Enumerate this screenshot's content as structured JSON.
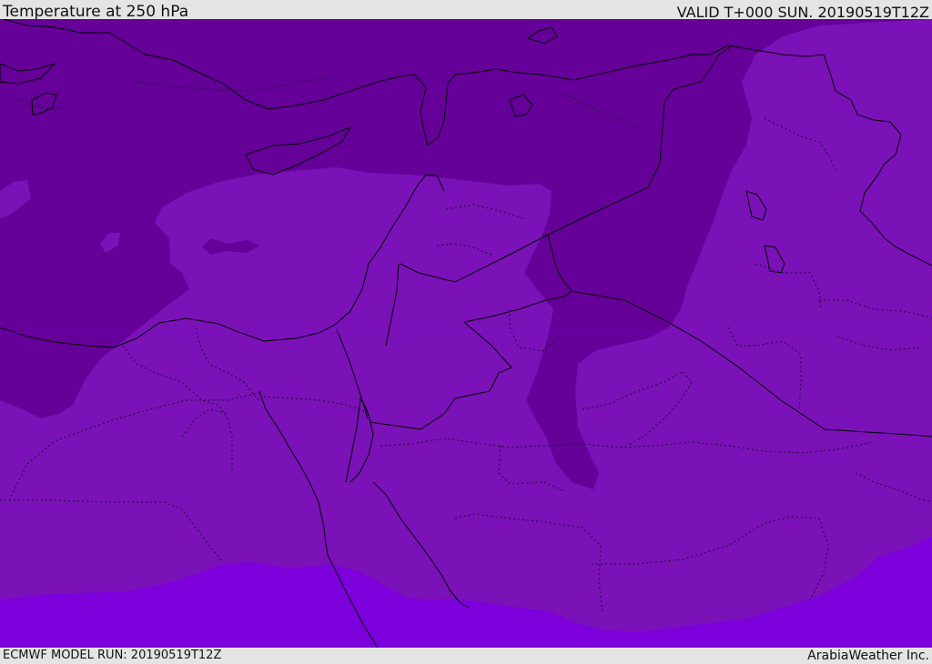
{
  "header": {
    "title": "Temperature at 250 hPa",
    "valid_time": "VALID T+000 SUN. 20190519T12Z"
  },
  "footer": {
    "model_run": "ECMWF MODEL RUN: 20190519T12Z",
    "credit": "ArabiaWeather Inc."
  },
  "map": {
    "variable": "temperature",
    "level": "250 hPa",
    "colors": {
      "coldest_band": "#650099",
      "middle_band": "#7a12b8",
      "warmest_band": "#7d00dc",
      "coastline": "#000000",
      "internal_boundary": "#1a0630"
    }
  }
}
